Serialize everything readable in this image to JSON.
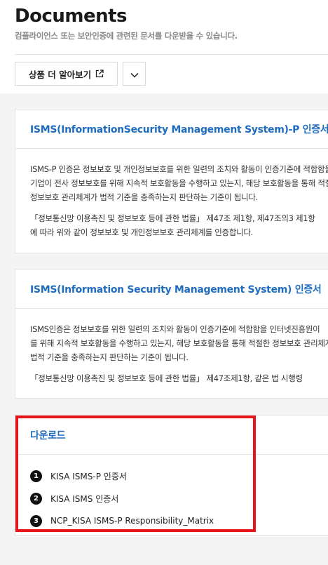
{
  "header": {
    "title": "Documents",
    "subtitle": "컴플라이언스 또는 보안인증에 관련된 문서를 다운받을 수 있습니다.",
    "learn_more_label": "상품 더 알아보기",
    "learn_more_icon": "external-link-icon",
    "more_icon": "chevron-down-icon"
  },
  "cards": [
    {
      "title": "ISMS(InformationSecurity Management System)-P 인증서",
      "lines": [
        "ISMS-P 인증은 정보보호 및 개인정보보호를 위한 일련의 조치와 활동이 인증기준에 적합함을",
        "기업이 전사 정보보호를 위해 지속적 보호활동을 수행하고 있는지, 해당 보호활동을 통해 적절한",
        "정보보호 관리체계가 법적 기준을 충족하는지 판단하는 기준이 됩니다.",
        "「정보통신망 이용촉진 및 정보보호 등에 관한 법률」 제47조 제1항, 제47조의3 제1항",
        "에 따라 위와 같이 정보보호 및 개인정보보호 관리체계를 인증합니다."
      ]
    },
    {
      "title": "ISMS(Information Security Management System) 인증서",
      "lines": [
        "ISMS인증은 정보보호를 위한 일련의 조치와 활동이 인증기준에 적합함을 인터넷진흥원이",
        "를 위해 지속적 보호활동을 수행하고 있는지, 해당 보호활동을 통해 적절한 정보보호 관리체계가",
        "법적 기준을 충족하는지 판단하는 기준이 됩니다.",
        "「정보통신망 이용촉진 및 정보보호 등에 관한 법률」 제47조제1항, 같은 법 시행령"
      ]
    }
  ],
  "download": {
    "title": "다운로드",
    "items": [
      {
        "num": "1",
        "label": "KISA ISMS-P 인증서"
      },
      {
        "num": "2",
        "label": "KISA ISMS 인증서"
      },
      {
        "num": "3",
        "label": "NCP_KISA ISMS-P Responsibility_Matrix"
      }
    ]
  },
  "colors": {
    "accent": "#1f6dc0",
    "highlight": "#e6141b",
    "background": "#f4f4f4"
  }
}
